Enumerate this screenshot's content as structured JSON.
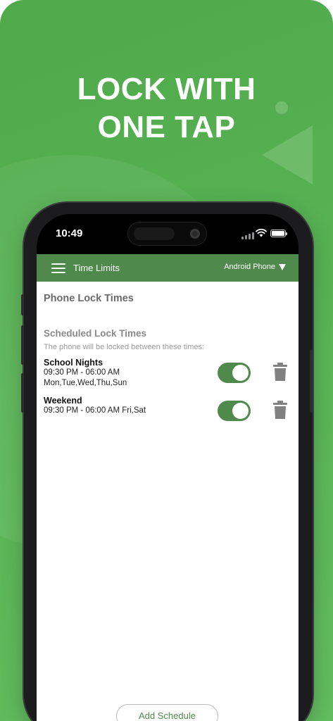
{
  "promo": {
    "headline_line1": "LOCK WITH",
    "headline_line2": "ONE TAP",
    "background_color": "#5ab556"
  },
  "status_bar": {
    "time": "10:49",
    "icons": [
      "signal-icon",
      "wifi-icon",
      "battery-icon"
    ]
  },
  "app_bar": {
    "title": "Time Limits",
    "device_selector": "Android Phone",
    "accent_color": "#4f8a4c",
    "icons": [
      "menu-icon",
      "caret-down-icon"
    ]
  },
  "page": {
    "title": "Phone Lock Times",
    "section_title": "Scheduled Lock Times",
    "section_subtitle": "The phone will be locked between these times:"
  },
  "schedules": [
    {
      "name": "School Nights",
      "time_range": "09:30 PM - 06:00 AM",
      "days": "Mon,Tue,Wed,Thu,Sun",
      "enabled": true
    },
    {
      "name": "Weekend",
      "time_range": "09:30 PM - 06:00 AM Fri,Sat",
      "enabled": true
    }
  ],
  "footer": {
    "add_button": "Add Schedule"
  }
}
